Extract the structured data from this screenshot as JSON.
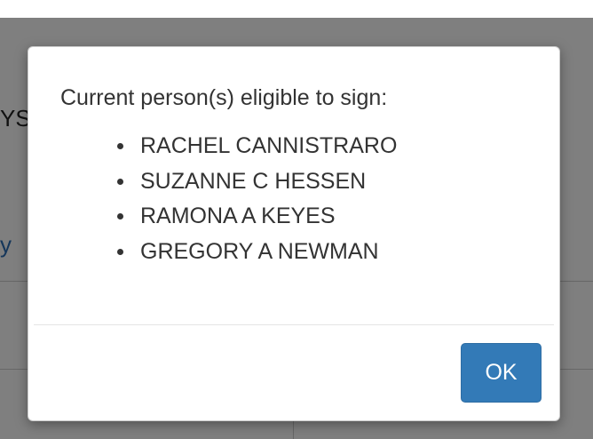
{
  "background": {
    "partial_text_left": "YS",
    "partial_link_left": "y"
  },
  "dialog": {
    "title": "Current person(s) eligible to sign:",
    "signers": [
      "RACHEL CANNISTRARO",
      "SUZANNE C HESSEN",
      "RAMONA A KEYES",
      "GREGORY A NEWMAN"
    ],
    "ok_label": "OK"
  },
  "colors": {
    "primary_button": "#337ab7",
    "backdrop": "rgba(0,0,0,0.5)"
  }
}
